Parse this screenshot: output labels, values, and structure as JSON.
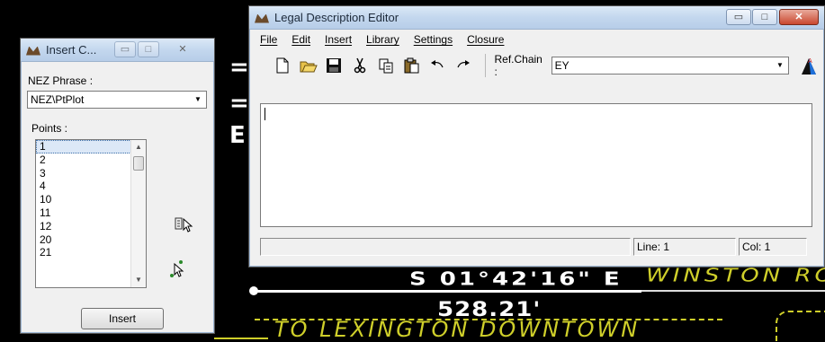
{
  "cad": {
    "bearing": "S 01°42'16\" E",
    "road": "WINSTON RO",
    "distance": "528.21'",
    "destination": "TO LEXINGTON DOWNTOWN",
    "fragments": [
      "=",
      "=",
      "E"
    ],
    "colors": {
      "white": "#ffffff",
      "yellow": "#cfcf2a",
      "background": "#000000"
    }
  },
  "insert_dialog": {
    "title": "Insert C...",
    "phrase_label": "NEZ Phrase :",
    "phrase_value": "NEZ\\PtPlot",
    "points_label": "Points :",
    "points": [
      "1",
      "2",
      "3",
      "4",
      "10",
      "11",
      "12",
      "20",
      "21"
    ],
    "selected_point": "1",
    "insert_button": "Insert",
    "icons": [
      "pick-points-icon",
      "select-cursor-icon"
    ]
  },
  "editor": {
    "title": "Legal Description Editor",
    "menu": [
      "File",
      "Edit",
      "Insert",
      "Library",
      "Settings",
      "Closure"
    ],
    "toolbar_icons": [
      "new-file-icon",
      "open-folder-icon",
      "save-icon",
      "cut-icon",
      "copy-icon",
      "paste-icon",
      "undo-icon",
      "redo-icon"
    ],
    "ref_chain_label": "Ref.Chain :",
    "ref_chain_value": "EY",
    "status_line": "Line: 1",
    "status_col": "Col: 1",
    "caption_buttons": {
      "minimize": "▭",
      "maximize": "□",
      "close": "✕"
    }
  }
}
